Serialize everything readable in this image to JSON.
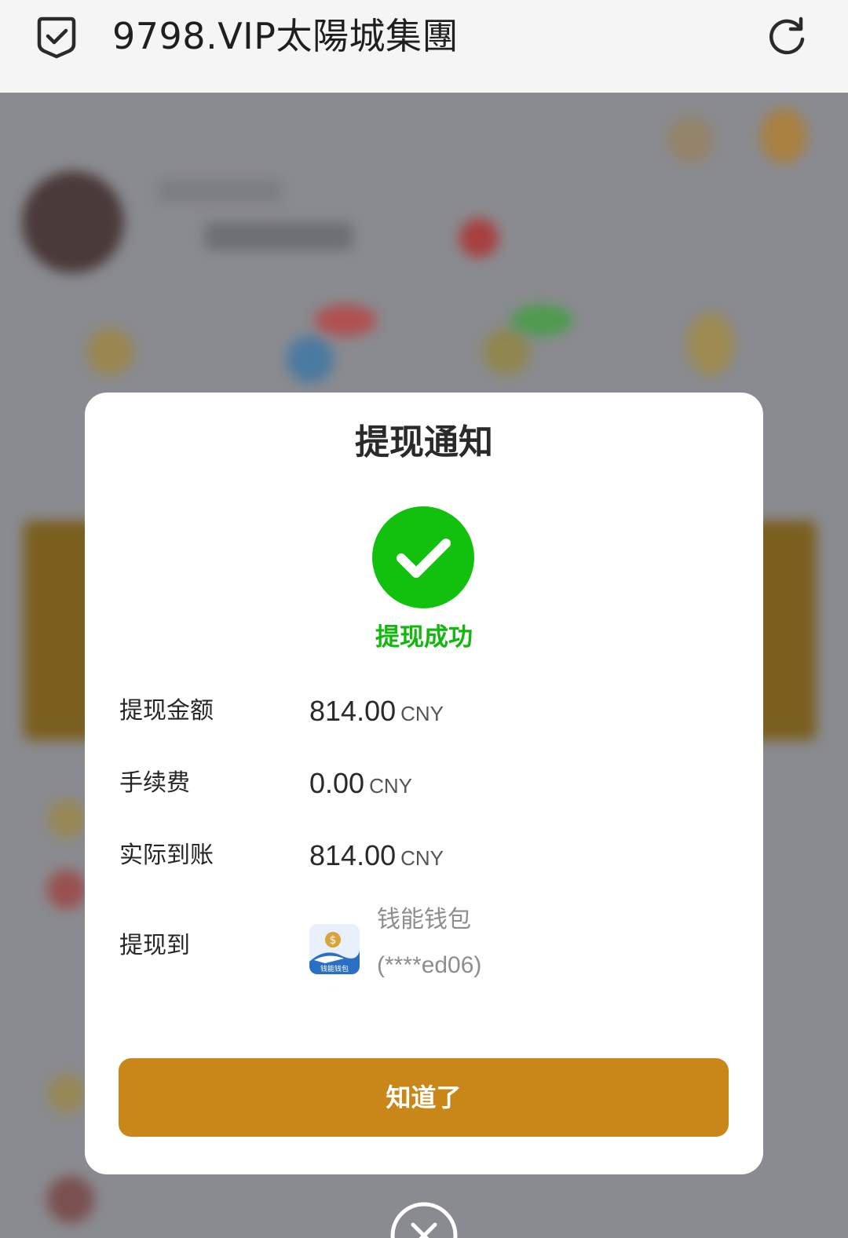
{
  "browser": {
    "title": "9798.VIP太陽城集團",
    "shield_icon": "shield-check-icon",
    "refresh_icon": "refresh-icon"
  },
  "dialog": {
    "title": "提现通知",
    "status_icon": "check-circle-icon",
    "status_text": "提现成功",
    "status_color": "#12b80e",
    "rows": [
      {
        "label": "提现金额",
        "value": "814.00",
        "unit": "CNY"
      },
      {
        "label": "手续费",
        "value": "0.00",
        "unit": "CNY"
      },
      {
        "label": "实际到账",
        "value": "814.00",
        "unit": "CNY"
      }
    ],
    "destination": {
      "label": "提现到",
      "wallet_name": "钱能钱包",
      "account": "(****ed06)",
      "wallet_icon_text": "钱能钱包"
    },
    "confirm_label": "知道了",
    "confirm_color": "#c98719",
    "close_icon": "close-circle-icon"
  }
}
